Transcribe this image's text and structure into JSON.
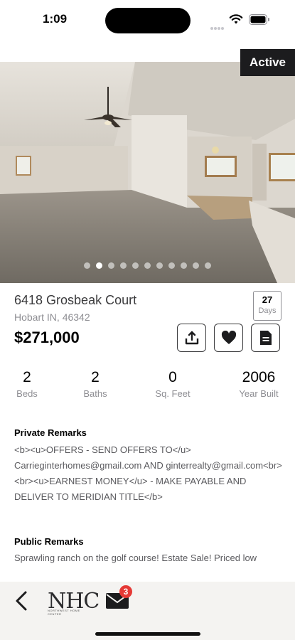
{
  "status": {
    "time": "1:09"
  },
  "listing": {
    "status_badge": "Active",
    "photo_count": 11,
    "current_photo_index": 1,
    "address": "6418 Grosbeak Court",
    "city_state_zip": "Hobart IN, 46342",
    "price": "$271,000",
    "days_on_market": {
      "value": "27",
      "label": "Days"
    }
  },
  "actions": {
    "share": "share-icon",
    "favorite": "heart-icon",
    "document": "document-icon"
  },
  "stats": [
    {
      "value": "2",
      "label": "Beds"
    },
    {
      "value": "2",
      "label": "Baths"
    },
    {
      "value": "0",
      "label": "Sq. Feet"
    },
    {
      "value": "2006",
      "label": "Year Built"
    }
  ],
  "remarks": {
    "private_title": "Private Remarks",
    "private_text": "<b><u>OFFERS - SEND OFFERS TO</u> Carrieginterhomes@gmail.com AND ginterrealty@gmail.com<br><br><u>EARNEST MONEY</u> - MAKE PAYABLE AND DELIVER TO MERIDIAN TITLE</b>",
    "public_title": "Public Remarks",
    "public_text": "Sprawling ranch on the golf course! Estate Sale! Priced low"
  },
  "bottom_bar": {
    "logo_text": "NHC",
    "logo_subtext": "NORTHWEST HOME CENTER",
    "mail_badge_count": "3"
  },
  "colors": {
    "badge_bg": "#1c1c1e",
    "notification": "#e53935",
    "bar_bg": "#f4f3f1"
  }
}
